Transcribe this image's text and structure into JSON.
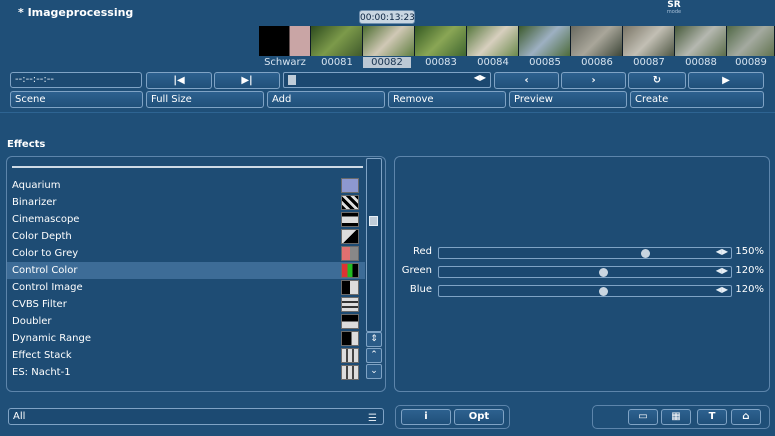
{
  "window": {
    "title": "* Imageprocessing",
    "badge": "SR",
    "badge_sub": "mode",
    "timecode": "00:00:13:23"
  },
  "timeline": {
    "thumbnails": [
      "Schwarz",
      "00081",
      "00082",
      "00083",
      "00084",
      "00085",
      "00086",
      "00087",
      "00088",
      "00089"
    ],
    "selected_index": 2,
    "timecode_field": "--:--:--:--"
  },
  "transport": {
    "first_frame": "|◀",
    "last_frame": "▶|",
    "prev": "‹",
    "next": "›",
    "loop": "↻",
    "play": "▶"
  },
  "toolbar": {
    "scene": "Scene",
    "full_size": "Full Size",
    "add": "Add",
    "remove": "Remove",
    "preview": "Preview",
    "create": "Create"
  },
  "effects": {
    "title": "Effects",
    "items": [
      {
        "label": "Aquarium",
        "icon": "aquarium-icon"
      },
      {
        "label": "Binarizer",
        "icon": "binarizer-icon"
      },
      {
        "label": "Cinemascope",
        "icon": "cinemascope-icon"
      },
      {
        "label": "Color Depth",
        "icon": "color-depth-icon"
      },
      {
        "label": "Color to Grey",
        "icon": "color-to-grey-icon"
      },
      {
        "label": "Control Color",
        "icon": "control-color-icon"
      },
      {
        "label": "Control Image",
        "icon": "control-image-icon"
      },
      {
        "label": "CVBS Filter",
        "icon": "cvbs-filter-icon"
      },
      {
        "label": "Doubler",
        "icon": "doubler-icon"
      },
      {
        "label": "Dynamic Range",
        "icon": "dynamic-range-icon"
      },
      {
        "label": "Effect Stack",
        "icon": "effect-stack-icon"
      },
      {
        "label": "ES: Nacht-1",
        "icon": "es-nacht-icon"
      }
    ],
    "selected_index": 5
  },
  "sliders": [
    {
      "label": "Red",
      "value": "150%",
      "level": 0.72
    },
    {
      "label": "Green",
      "value": "120%",
      "level": 0.57
    },
    {
      "label": "Blue",
      "value": "120%",
      "level": 0.57
    }
  ],
  "bottom": {
    "filter": "All",
    "info": "i",
    "opt": "Opt",
    "text_icon": "T"
  },
  "colors": {
    "background": "#1f4f78",
    "selected_row": "#3d6c97",
    "selected_thumb_label": "#bcc8d4"
  }
}
